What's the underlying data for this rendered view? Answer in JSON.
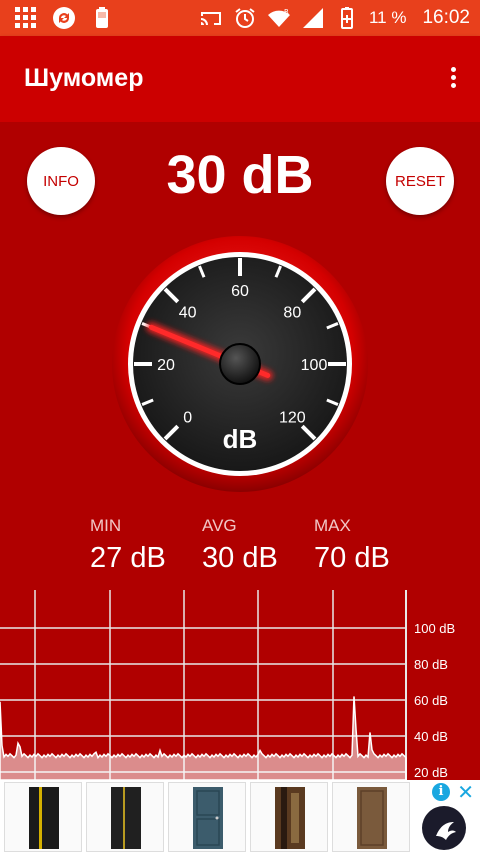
{
  "status_bar": {
    "battery_percent": "11 %",
    "time": "16:02",
    "icons": [
      "grid-icon",
      "sync-icon",
      "battery-card-icon",
      "cast-icon",
      "alarm-icon",
      "wifi-icon",
      "signal-icon",
      "battery-icon"
    ]
  },
  "appbar": {
    "title": "Шумомер",
    "menu_icon": "more-vert-icon"
  },
  "buttons": {
    "info": "INFO",
    "reset": "RESET"
  },
  "current": {
    "value": "30 dB",
    "db": 30
  },
  "gauge": {
    "unit": "dB",
    "scale_labels": [
      "0",
      "20",
      "40",
      "60",
      "80",
      "100",
      "120"
    ],
    "min": 0,
    "max": 120
  },
  "stats": {
    "min_label": "MIN",
    "min_value": "27 dB",
    "avg_label": "AVG",
    "avg_value": "30 dB",
    "max_label": "MAX",
    "max_value": "70 dB"
  },
  "graph": {
    "y_labels": [
      "100 dB",
      "80 dB",
      "60 dB",
      "40 dB",
      "20 dB"
    ],
    "y_values": [
      100,
      80,
      60,
      40,
      20
    ]
  },
  "ad": {
    "tiles": 5,
    "info_glyph": "i",
    "close_glyph": "✕"
  },
  "colors": {
    "status_bar": "#e8401c",
    "app_bar": "#cc0000",
    "background": "#b00000",
    "needle": "#ff2020"
  }
}
